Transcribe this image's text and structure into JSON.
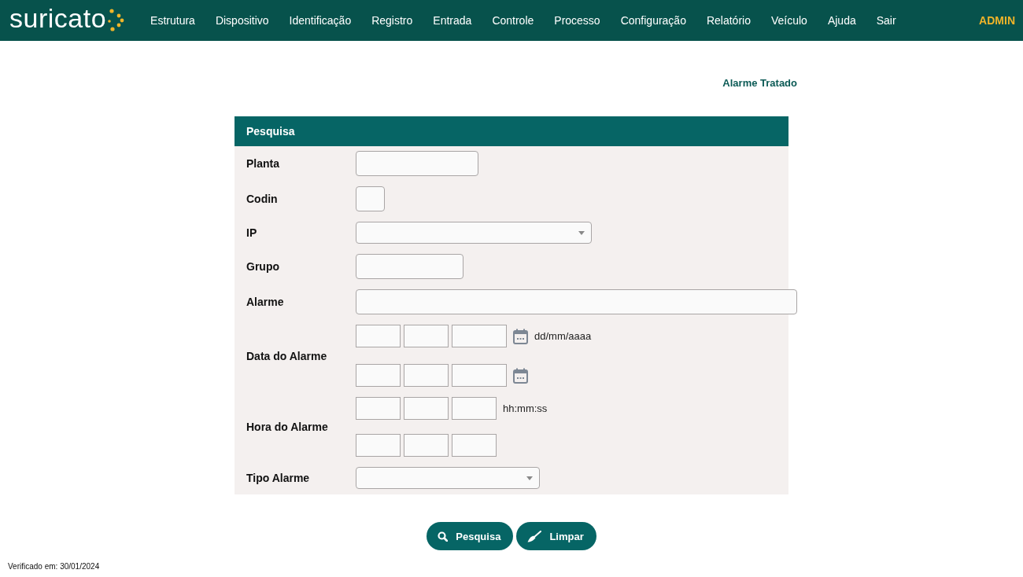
{
  "nav": {
    "logo": "suricato",
    "menu": [
      "Estrutura",
      "Dispositivo",
      "Identificação",
      "Registro",
      "Entrada",
      "Controle",
      "Processo",
      "Configuração",
      "Relatório",
      "Veículo",
      "Ajuda",
      "Sair"
    ],
    "user": "ADMIN"
  },
  "page_title": "Alarme Tratado",
  "panel": {
    "title": "Pesquisa",
    "fields": [
      {
        "label": "Planta",
        "kind": "text"
      },
      {
        "label": "Codin",
        "kind": "text"
      },
      {
        "label": "IP",
        "kind": "select"
      },
      {
        "label": "Grupo",
        "kind": "text"
      },
      {
        "label": "Alarme",
        "kind": "text"
      },
      {
        "label": "Data do Alarme",
        "kind": "date-range",
        "hint": "dd/mm/aaaa"
      },
      {
        "label": "Hora do Alarme",
        "kind": "time-range",
        "hint": "hh:mm:ss"
      },
      {
        "label": "Tipo Alarme",
        "kind": "select"
      }
    ]
  },
  "buttons": [
    {
      "label": "Pesquisa",
      "kind": "search"
    },
    {
      "label": "Limpar",
      "kind": "clear"
    }
  ],
  "footer": "Verificado em: 30/01/2024"
}
